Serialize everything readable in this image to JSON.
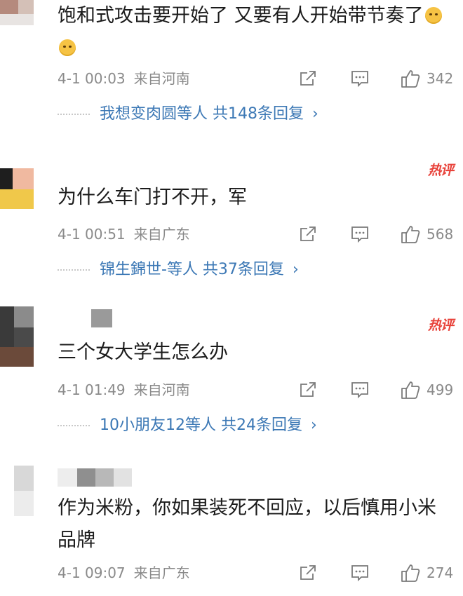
{
  "comments": [
    {
      "text": "饱和式攻击要开始了 又要有人开始带节奏了",
      "date": "4-1 00:03",
      "location": "来自河南",
      "likes": "342",
      "hot_badge": "",
      "replies_text": "我想变肉圆等人 共148条回复"
    },
    {
      "text": "为什么车门打不开，军",
      "date": "4-1 00:51",
      "location": "来自广东",
      "likes": "568",
      "hot_badge": "热评",
      "replies_text": "锦生錦世-等人 共37条回复"
    },
    {
      "text": "三个女大学生怎么办",
      "date": "4-1 01:49",
      "location": "来自河南",
      "likes": "499",
      "hot_badge": "热评",
      "replies_text": "10小朋友12等人 共24条回复"
    },
    {
      "text": "作为米粉，你如果装死不回应，以后慎用小米品牌",
      "date": "4-1 09:07",
      "location": "来自广东",
      "likes": "274",
      "hot_badge": "",
      "replies_text": ""
    }
  ],
  "icons": {
    "share": "share-icon",
    "comment": "comment-icon",
    "like": "like-icon",
    "reply_arrow": "chevron-right-icon",
    "emoji": "dog-face-emoji"
  },
  "symbols": {
    "chevron": "›"
  },
  "colors": {
    "link": "#3c78b5",
    "meta": "#8a8a8a",
    "hot": "#e8423a",
    "text": "#1b1b1b"
  }
}
